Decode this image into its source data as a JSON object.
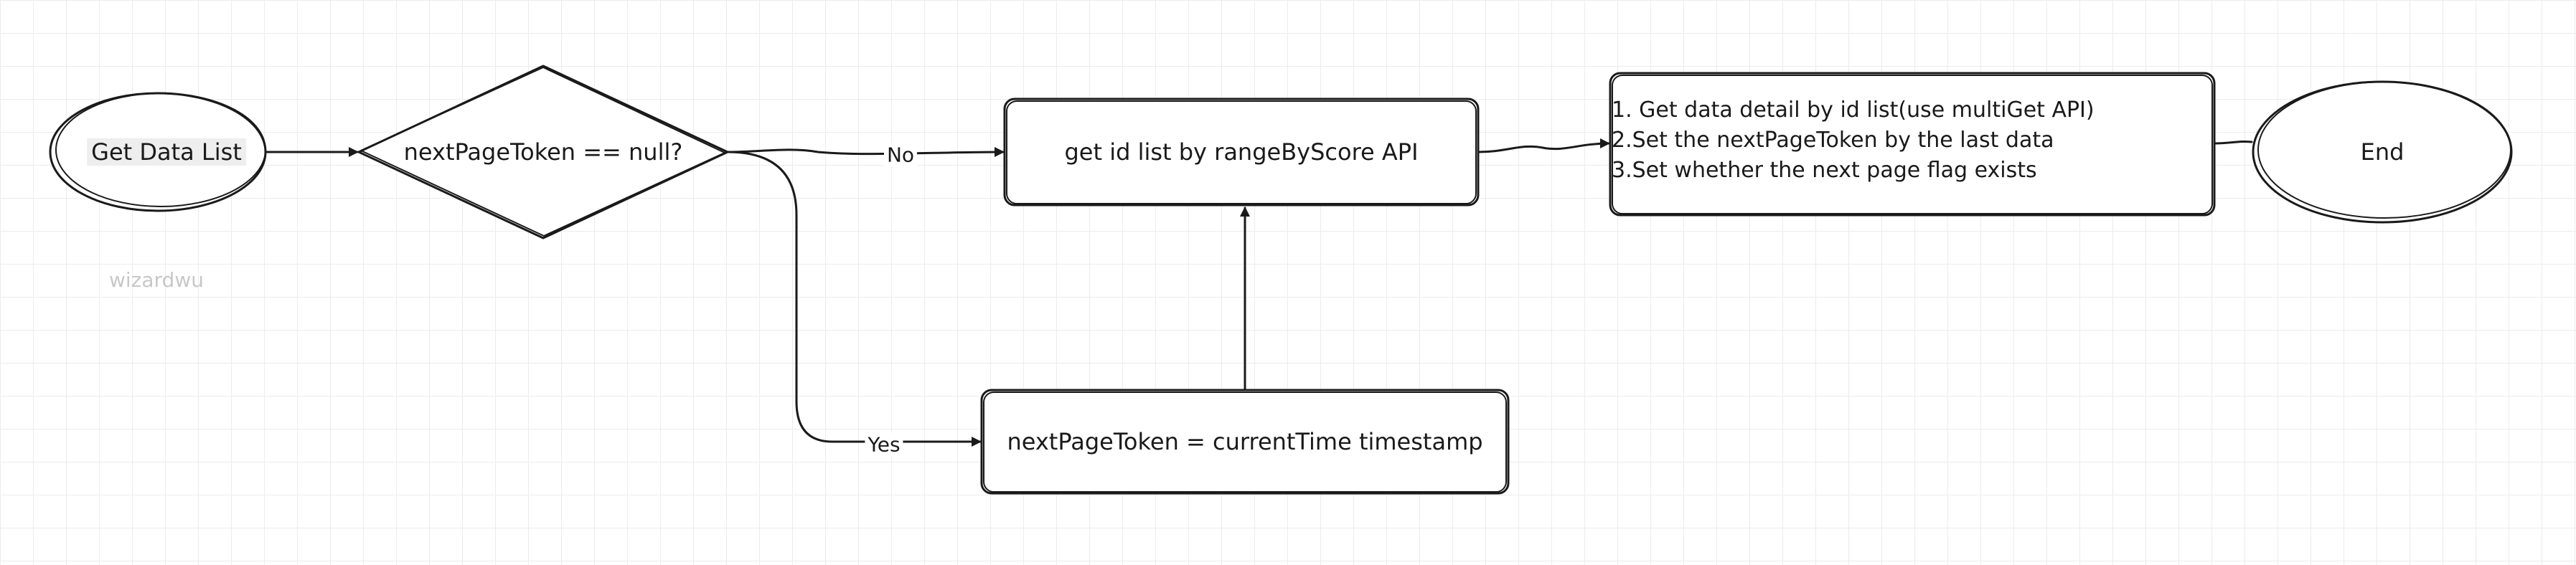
{
  "nodes": {
    "start": {
      "label": "Get Data List"
    },
    "decision": {
      "label": "nextPageToken == null?"
    },
    "get_ids": {
      "label": "get id list by rangeByScore API"
    },
    "set_token": {
      "label": "nextPageToken = currentTime timestamp"
    },
    "process": {
      "lines": [
        "1. Get data detail by id list(use multiGet API)",
        "2.Set the nextPageToken by the last data",
        "3.Set whether the next page flag exists"
      ]
    },
    "end": {
      "label": "End"
    }
  },
  "edges": {
    "no_label": "No",
    "yes_label": "Yes"
  },
  "watermark": "wizardwu",
  "colors": {
    "stroke": "#1a1a1a",
    "grid": "#ececec",
    "background": "#ffffff"
  }
}
